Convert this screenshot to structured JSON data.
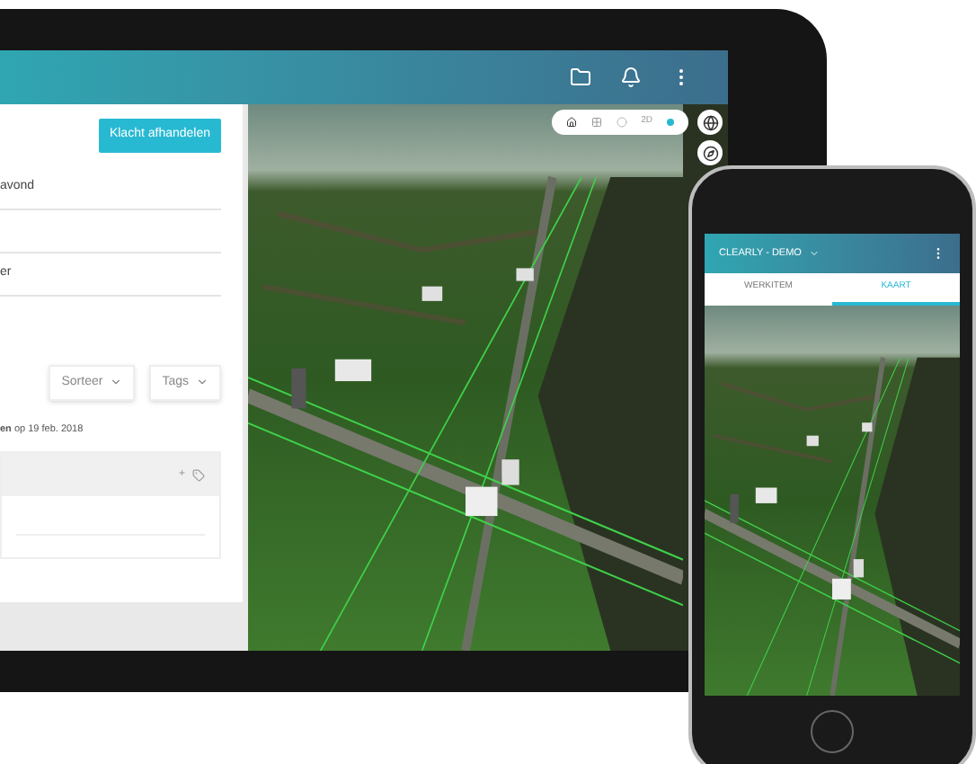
{
  "tablet": {
    "panel": {
      "action_button": "Klacht afhandelen",
      "fields": [
        {
          "kind": "text",
          "value": "avond"
        },
        {
          "kind": "blank"
        },
        {
          "kind": "text",
          "value": "er"
        }
      ],
      "sort_button": "Sorteer",
      "tags_button": "Tags",
      "meta": "**en** op 19 feb. 2018",
      "card": {
        "add": "+"
      }
    },
    "map_toolbar": {
      "mode": "2D"
    }
  },
  "phone": {
    "title": "CLEARLY - DEMO",
    "tabs": [
      {
        "label": "WERKITEM",
        "selected": false
      },
      {
        "label": "KAART",
        "selected": true
      }
    ]
  }
}
